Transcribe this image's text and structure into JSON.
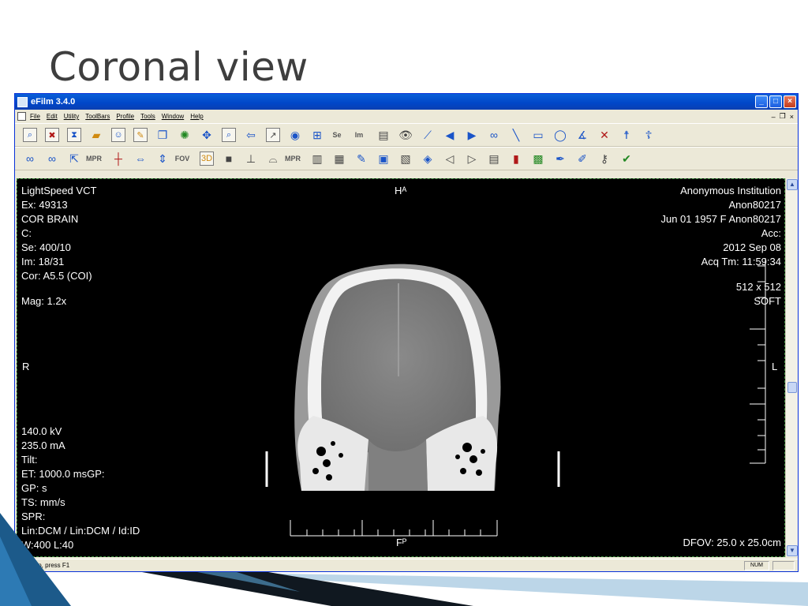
{
  "slide": {
    "title": "Coronal view"
  },
  "window": {
    "title": "eFilm 3.4.0"
  },
  "menu": [
    "File",
    "Edit",
    "Utility",
    "ToolBars",
    "Profile",
    "Tools",
    "Window",
    "Help"
  ],
  "toolbar": {
    "fov_label": "FOV",
    "mpr_label": "MPR",
    "se_label": "Se",
    "im_label": "Im"
  },
  "overlay": {
    "top_left": [
      "LightSpeed VCT",
      "Ex: 49313",
      "COR BRAIN",
      "C:",
      "Se: 400/10",
      "Im: 18/31",
      "Cor: A5.5 (COI)"
    ],
    "mag": "Mag: 1.2x",
    "orient_right": "R",
    "orient_left": "L",
    "orient_top": "Hᴬ",
    "orient_bottom": "Fᴾ",
    "top_right": [
      "Anonymous Institution",
      "Anon80217",
      "Jun 01 1957 F Anon80217",
      "Acc:",
      "2012 Sep 08",
      "Acq Tm: 11:59:34"
    ],
    "matrix": "512 x 512",
    "filter": "SOFT",
    "bottom_left": [
      "140.0 kV",
      "235.0 mA",
      "Tilt:",
      "ET: 1000.0 msGP:",
      "GP:  s",
      "TS:  mm/s",
      "SPR:",
      "Lin:DCM / Lin:DCM / Id:ID",
      "W:400  L:40"
    ],
    "dfov": "DFOV: 25.0 x 25.0cm"
  },
  "status": {
    "help": "For Help, press F1",
    "num": "NUM"
  },
  "colors": {
    "titlebar": "#0a5fd8",
    "viewport_bg": "#000000",
    "overlay_text": "#ffffff",
    "chrome": "#ece9d8"
  }
}
